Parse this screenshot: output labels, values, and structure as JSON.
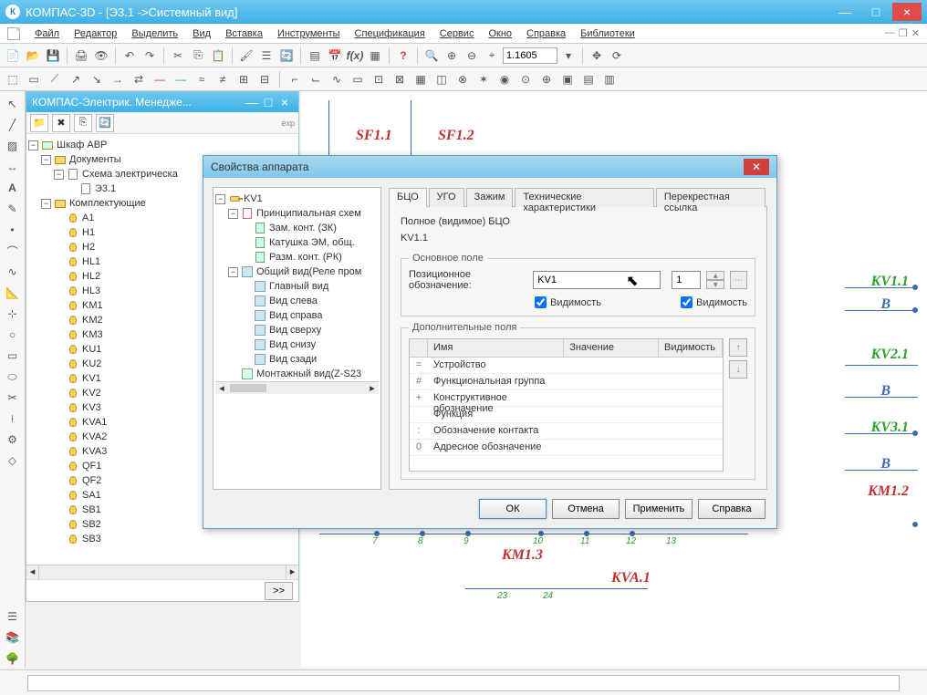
{
  "window": {
    "title": "КОМПАС-3D - [Э3.1 ->Системный вид]",
    "icon_letter": "К"
  },
  "menu": [
    "Файл",
    "Редактор",
    "Выделить",
    "Вид",
    "Вставка",
    "Инструменты",
    "Спецификация",
    "Сервис",
    "Окно",
    "Справка",
    "Библиотеки"
  ],
  "zoom": "1.1605",
  "panel": {
    "title": "КОМПАС-Электрик. Менедже...",
    "footer_btn": ">>"
  },
  "manager_tree": {
    "root": "Шкаф АВР",
    "docs": "Документы",
    "schema": "Схема электрическа",
    "sheet": "Э3.1",
    "komp": "Комплектующие",
    "items": [
      "A1",
      "H1",
      "H2",
      "HL1",
      "HL2",
      "HL3",
      "KM1",
      "KM2",
      "KM3",
      "KU1",
      "KU2",
      "KV1",
      "KV2",
      "KV3",
      "KVA1",
      "KVA2",
      "KVA3",
      "QF1",
      "QF2",
      "SA1",
      "SB1",
      "SB2",
      "SB3"
    ]
  },
  "dialog": {
    "title": "Свойства аппарата",
    "tree": {
      "root": "KV1",
      "princ": "Принципиальная схем",
      "princ_items": [
        "Зам. конт. (ЗК)",
        "Катушка ЭМ, общ.",
        "Разм. конт. (РК)"
      ],
      "obsh": "Общий вид(Реле пром",
      "views": [
        "Главный вид",
        "Вид слева",
        "Вид справа",
        "Вид сверху",
        "Вид снизу",
        "Вид сзади"
      ],
      "mont": "Монтажный вид(Z-S23"
    },
    "tabs": [
      "БЦО",
      "УГО",
      "Зажим",
      "Технические характеристики",
      "Перекрестная ссылка"
    ],
    "full_label": "Полное (видимое) БЦО",
    "full_value": "KV1.1",
    "main_group": "Основное поле",
    "pos_label": "Позиционное обозначение:",
    "pos_value": "KV1",
    "pos_num": "1",
    "vis1": "Видимость",
    "vis2": "Видимость",
    "add_group": "Дополнительные поля",
    "grid_headers": [
      "Имя",
      "Значение",
      "Видимость"
    ],
    "grid_rows": [
      {
        "sym": "=",
        "name": "Устройство"
      },
      {
        "sym": "#",
        "name": "Функциональная группа"
      },
      {
        "sym": "+",
        "name": "Конструктивное обозначение"
      },
      {
        "sym": "",
        "name": "Функция"
      },
      {
        "sym": ":",
        "name": "Обозначение контакта"
      },
      {
        "sym": "0",
        "name": "Адресное обозначение"
      }
    ],
    "buttons": {
      "ok": "ОК",
      "cancel": "Отмена",
      "apply": "Применить",
      "help": "Справка"
    }
  },
  "canvas_labels": {
    "sf11": "SF1.1",
    "sf12": "SF1.2",
    "kv11": "KV1.1",
    "kv21": "KV2.1",
    "kv31": "KV3.1",
    "km12": "KM1.2",
    "km13": "KM1.3",
    "kva1": "KVA.1",
    "b": "В",
    "exp": "exp"
  },
  "canvas_nums": [
    "7",
    "8",
    "9",
    "10",
    "11",
    "12",
    "13",
    "23",
    "24"
  ]
}
